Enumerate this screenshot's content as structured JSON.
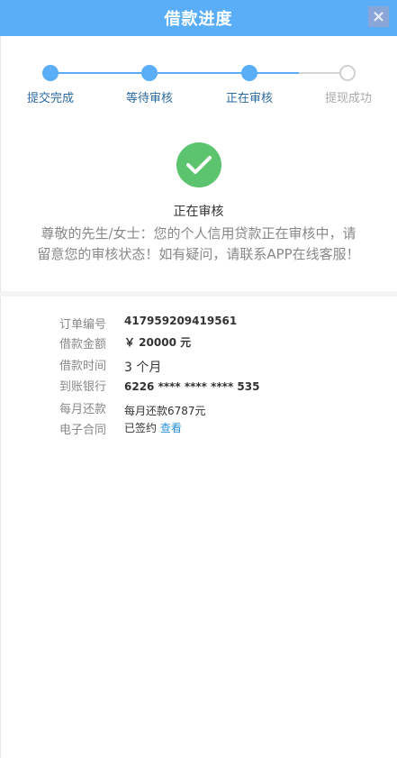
{
  "header": {
    "title": "借款进度",
    "close_label": "×"
  },
  "steps": [
    {
      "label": "提交完成",
      "state": "done"
    },
    {
      "label": "等待审核",
      "state": "done"
    },
    {
      "label": "正在审核",
      "state": "done"
    },
    {
      "label": "提现成功",
      "state": "todo"
    }
  ],
  "status": {
    "icon": "check-icon",
    "title": "正在审核",
    "description": "尊敬的先生/女士：您的个人信用贷款正在审核中，请留意您的审核状态！如有疑问，请联系APP在线客服！"
  },
  "details": [
    {
      "label": "订单编号",
      "value": "417959209419561"
    },
    {
      "label": "借款金额",
      "value": "￥ 20000 元"
    },
    {
      "label": "借款时间",
      "value": "3 个月"
    },
    {
      "label": "到账银行",
      "value": "6226 **** **** **** 535"
    },
    {
      "label": "每月还款",
      "value": "每月还款6787元"
    },
    {
      "label": "电子合同",
      "value": "已签约",
      "link": "查看"
    }
  ],
  "colors": {
    "header": "#59aef7",
    "step_done": "#59aef7",
    "step_todo": "#cfcfcf",
    "check": "#5cc46f",
    "link": "#2a8fd6"
  }
}
